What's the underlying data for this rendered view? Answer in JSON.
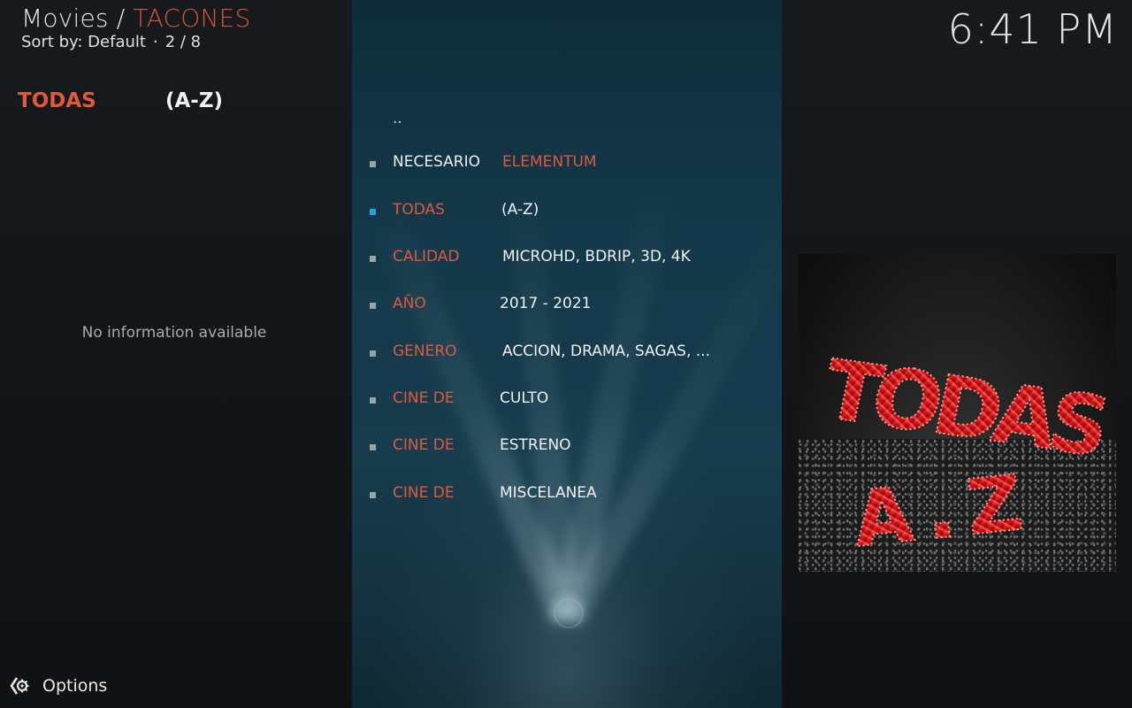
{
  "header": {
    "path_root": "Movies",
    "path_separator": " / ",
    "path_current": "TACONES",
    "sort_label": "Sort by: Default",
    "sort_dot": "·",
    "position": "2 / 8",
    "clock": "6:41 PM"
  },
  "info_panel": {
    "label_a": "TODAS",
    "label_b": "(A-Z)",
    "no_info": "No information available"
  },
  "list": {
    "parent_item": "..",
    "items": [
      {
        "c1": "NECESARIO",
        "c2": "ELEMENTUM",
        "active": false
      },
      {
        "c1": "TODAS",
        "c2": "(A-Z)",
        "active": true
      },
      {
        "c1": "CALIDAD",
        "c2": "MICROHD, BDRIP, 3D, 4K",
        "active": false
      },
      {
        "c1": "AÑO",
        "c2": "2017 - 2021",
        "active": false
      },
      {
        "c1": "GENERO",
        "c2": "ACCION, DRAMA, SAGAS, ...",
        "active": false
      },
      {
        "c1": "CINE DE",
        "c2": "CULTO",
        "active": false
      },
      {
        "c1": "CINE DE",
        "c2": "ESTRENO",
        "active": false
      },
      {
        "c1": "CINE DE",
        "c2": "MISCELANEA",
        "active": false
      }
    ]
  },
  "poster": {
    "line1": "TODAS",
    "line2": "A.Z"
  },
  "footer": {
    "options_label": "Options",
    "icon": "gear-icon"
  },
  "colors": {
    "accent_red": "#de5a3c",
    "accent_blue": "#23a6d5",
    "panel_bg": "#14394a"
  }
}
